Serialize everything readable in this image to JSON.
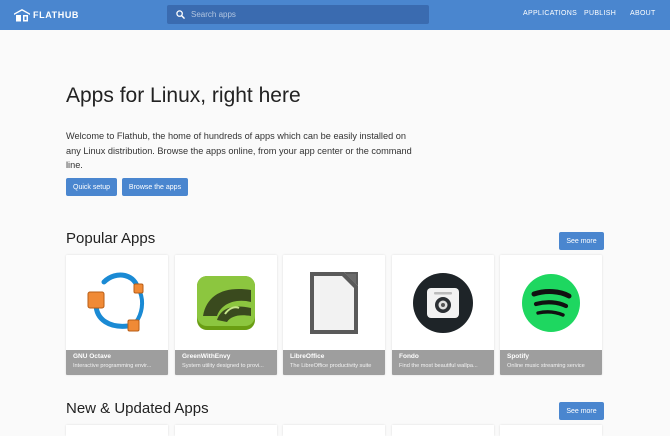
{
  "header": {
    "logo_text": "FLATHUB",
    "search_placeholder": "Search apps",
    "nav": [
      "APPLICATIONS",
      "PUBLISH",
      "ABOUT"
    ]
  },
  "hero": {
    "title": "Apps for Linux, right here",
    "description": "Welcome to Flathub, the home of hundreds of apps which can be easily installed on any Linux distribution. Browse the apps online, from your app center or the command line.",
    "quick_setup": "Quick setup",
    "browse": "Browse the apps"
  },
  "popular": {
    "title": "Popular Apps",
    "see_more": "See more",
    "apps": [
      {
        "name": "GNU Octave",
        "summary": "Interactive programming envir...",
        "icon": "octave-icon"
      },
      {
        "name": "GreenWithEnvy",
        "summary": "System utility designed to provi...",
        "icon": "greenwithenvy-icon"
      },
      {
        "name": "LibreOffice",
        "summary": "The LibreOffice productivity suite",
        "icon": "libreoffice-icon"
      },
      {
        "name": "Fondo",
        "summary": "Find the most beautiful wallpa...",
        "icon": "fondo-icon"
      },
      {
        "name": "Spotify",
        "summary": "Online music streaming service",
        "icon": "spotify-icon"
      }
    ]
  },
  "new_updated": {
    "title": "New & Updated Apps",
    "see_more": "See more"
  },
  "colors": {
    "header": "#4a86cf",
    "accent": "#4a86cf",
    "caption": "#9e9e9e",
    "octave_orange": "#f08a36",
    "spotify_green": "#1ed760",
    "gwe_green": "#76b900"
  }
}
